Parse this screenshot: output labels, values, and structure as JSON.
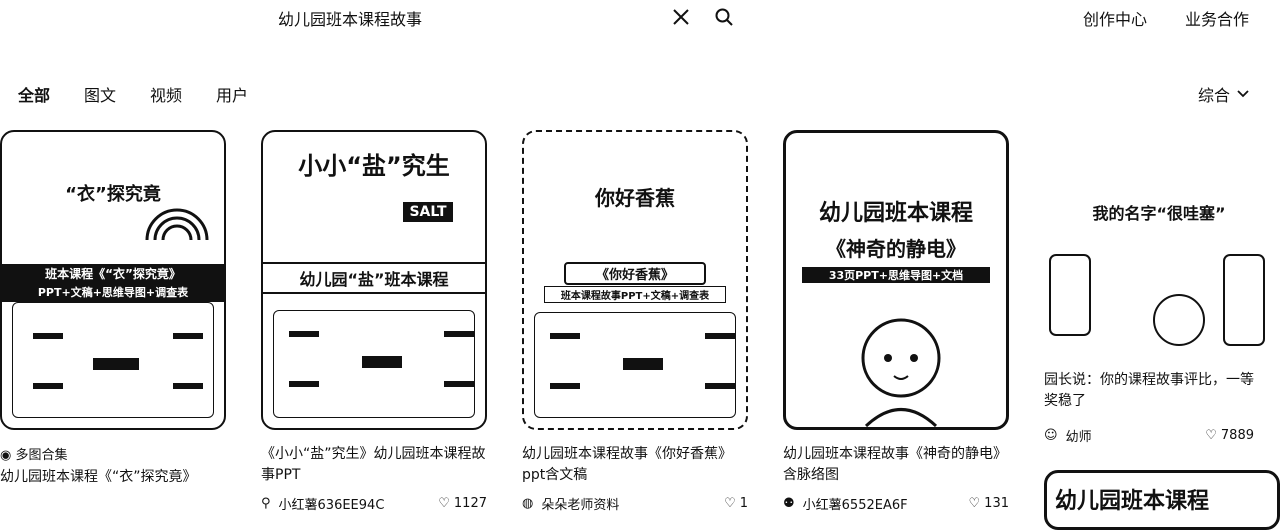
{
  "search": {
    "query": "幼儿园班本课程故事"
  },
  "top_links": [
    "创作中心",
    "业务合作"
  ],
  "tabs": [
    "全部",
    "图文",
    "视频",
    "用户"
  ],
  "sort": {
    "label": "综合"
  },
  "cards": [
    {
      "meta": "多图合集",
      "title": "幼儿园班本课程《“衣”探究竟》",
      "author": "",
      "likes": "",
      "poster_lines": [
        "“衣”探究竟",
        "班本课程《“衣”探究竟》",
        "PPT+文稿+思维导图+调查表"
      ]
    },
    {
      "title": "《小小“盐”究生》幼儿园班本课程故事PPT",
      "author": "小红薯636EE94C",
      "likes": "1127",
      "poster_lines": [
        "小小“盐”究生",
        "SALT",
        "幼儿园“盐”班本课程"
      ]
    },
    {
      "title": "幼儿园班本课程故事《你好香蕉》ppt含文稿",
      "author": "朵朵老师资料",
      "likes": "1",
      "poster_lines": [
        "你好香蕉",
        "《你好香蕉》",
        "班本课程故事PPT+文稿+调查表"
      ]
    },
    {
      "title": "幼儿园班本课程故事《神奇的静电》含脉络图",
      "author": "小红薯6552EA6F",
      "likes": "131",
      "poster_lines": [
        "幼儿园班本课程",
        "《神奇的静电》",
        "33页PPT+思维导图+文档"
      ]
    },
    {
      "title": "园长说：你的课程故事评比，一等奖稳了",
      "author": "幼师",
      "likes": "7889",
      "poster_lines": [
        "我的名字“很哇塞”"
      ]
    }
  ],
  "partial_card": {
    "poster_line": "幼儿园班本课程"
  }
}
